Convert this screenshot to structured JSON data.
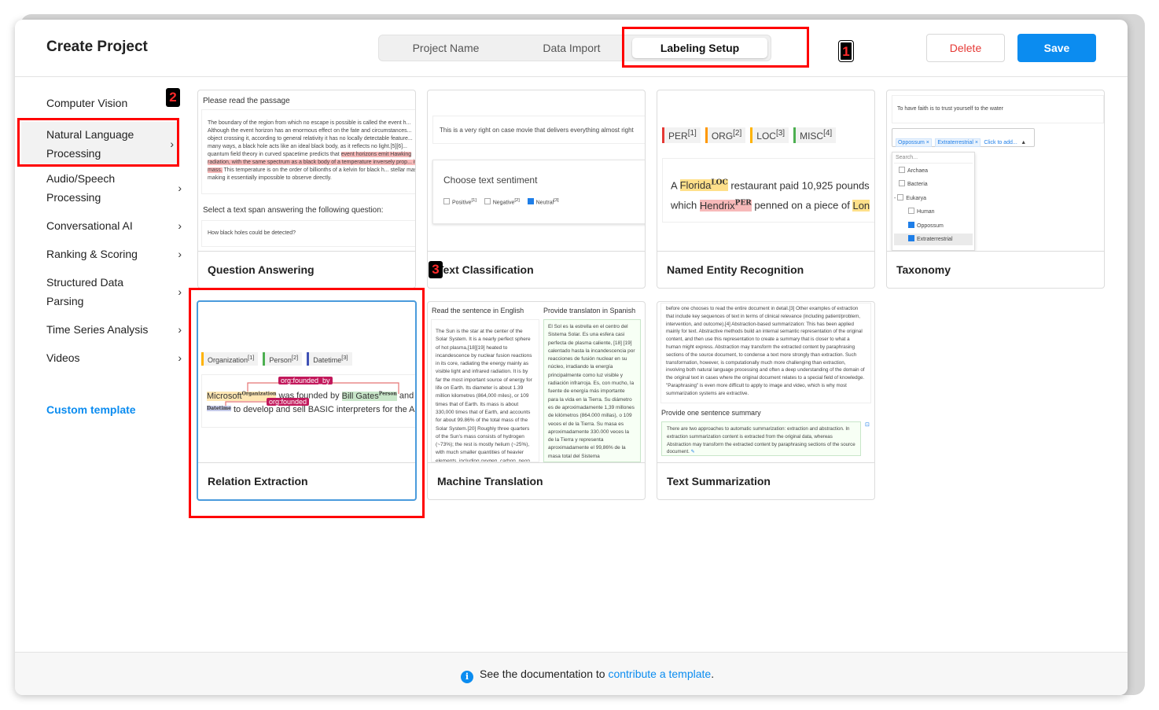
{
  "header": {
    "title": "Create Project",
    "tabs": [
      "Project Name",
      "Data Import",
      "Labeling Setup"
    ],
    "delete_label": "Delete",
    "save_label": "Save",
    "marker_1": "1"
  },
  "sidebar": {
    "items": [
      {
        "label": "Computer Vision"
      },
      {
        "label": "Natural Language Processing"
      },
      {
        "label": "Audio/Speech Processing"
      },
      {
        "label": "Conversational AI"
      },
      {
        "label": "Ranking & Scoring"
      },
      {
        "label": "Structured Data Parsing"
      },
      {
        "label": "Time Series Analysis"
      },
      {
        "label": "Videos"
      }
    ],
    "custom_template": "Custom template",
    "marker_2": "2"
  },
  "cards": {
    "qa": {
      "title": "Question Answering",
      "p1": "Please read the passage",
      "passage_a": "The boundary of the region from which no escape is possible is called the event h... Although the event horizon has an enormous effect on the fate and circumstances... object crossing it, according to general relativity it has no locally detectable feature... many ways, a black hole acts like an ideal black body, as it reflects no light.[5][6]... quantum field theory in curved spacetime predicts that",
      "passage_hl": "event horizons emit Hawking radiation, with the same spectrum as a black body of a temperature inversely prop... its mass.",
      "passage_b": "This temperature is on the order of billionths of a kelvin for black h... stellar mass, making it essentially impossible to observe directly.",
      "p2": "Select a text span answering the following question:",
      "question": "How black holes could be detected?"
    },
    "tc": {
      "title": "Text Classification",
      "sentence": "This is a very right on case movie that delivers everything almost right",
      "choose": "Choose text sentiment",
      "options": [
        "Positive",
        "Negative",
        "Neutral"
      ],
      "marker_3": "3"
    },
    "ner": {
      "title": "Named Entity Recognition",
      "tags": [
        "PER",
        "ORG",
        "LOC",
        "MISC"
      ],
      "sentence_1a": "A",
      "entity_1": "Florida",
      "entity_1_tag": "LOC",
      "sentence_1b": "restaurant paid 10,925 pounds",
      "sentence_2a": "which",
      "entity_2": "Hendrix",
      "entity_2_tag": "PER",
      "sentence_2b": "penned on a piece of",
      "entity_3": "Lon"
    },
    "tax": {
      "title": "Taxonomy",
      "quote": "To have faith is to trust yourself to the water",
      "selected": [
        "Oppossum",
        "Extraterrestrial"
      ],
      "click_to_add": "Click to add...",
      "search": "Search...",
      "tree": [
        "Archaea",
        "Bacteria",
        "Eukarya",
        "Human",
        "Oppossum",
        "Extraterrestrial"
      ]
    },
    "re": {
      "title": "Relation Extraction",
      "tags": [
        "Organization",
        "Person",
        "Datetime"
      ],
      "rel_1": "org:founded_by",
      "rel_2": "org:founded",
      "line_1a": "Microsoft",
      "line_1b": "was founded by",
      "line_1c": "Bill Gates",
      "line_1d": "and",
      "line_2": "to develop and sell BASIC interpreters for the Al"
    },
    "mt": {
      "title": "Machine Translation",
      "left_head": "Read the sentence in English",
      "right_head": "Provide translaton in Spanish",
      "left_text": "The Sun is the star at the center of the Solar System. It is a nearly perfect sphere of hot plasma,[18][19] heated to incandescence by nuclear fusion reactions in its core, radiating the energy mainly as visible light and infrared radiation. It is by far the most important source of energy for life on Earth. Its diameter is about 1.39 million kilometres (864,000 miles), or 109 times that of Earth. Its mass is about 330,000 times that of Earth, and accounts for about 99.86% of the total mass of the Solar System.[20] Roughly three quarters of the Sun's mass consists of hydrogen (~73%); the rest is mostly helium (~25%), with much smaller quantities of heavier elements, including oxygen, carbon, neon,",
      "right_text": "El Sol es la estrella en el centro del Sistema Solar. Es una esfera casi perfecta de plasma caliente, [18] [19] calentado hasta la incandescencia por reacciones de fusión nuclear en su núcleo, irradiando la energía principalmente como luz visible y radiación infrarroja. Es, con mucho, la fuente de energía más importante para la vida en la Tierra. Su diámetro es de aproximadamente 1,39 millones de kilómetros (864.000 millas), o 109 veces el de la Tierra. Su masa es aproximadamente 330.000 veces la de la Tierra y representa aproximadamente el 99,86% de la masa total del Sistema"
    },
    "ts": {
      "title": "Text Summarization",
      "doc": "before one chooses to read the entire document in detail.[3] Other examples of extraction that include key sequences of text in terms of clinical relevance (including patient/problem, intervention, and outcome).[4] Abstraction-based summarization: This has been applied mainly for text. Abstractive methods build an internal semantic representation of the original content, and then use this representation to create a summary that is closer to what a human might express. Abstraction may transform the extracted content by paraphrasing sections of the source document, to condense a text more strongly than extraction. Such transformation, however, is computationally much more challenging than extraction, involving both natural language processing and often a deep understanding of the domain of the original text in cases where the original document relates to a special field of knowledge. \"Paraphrasing\" is even more difficult to apply to image and video, which is why most summarization systems are extractive.",
      "prompt": "Provide one sentence summary",
      "summary": "There are two approaches to automatic summarization: extraction and abstraction. In extraction summarization content is extracted from the original data, whereas Abstraction may transform the extracted content by paraphrasing sections of the source document."
    }
  },
  "footer": {
    "prefix": "See the documentation to ",
    "link": "contribute a template",
    "suffix": "."
  },
  "colors": {
    "accent": "#0b8cf0",
    "delete": "#e53935",
    "highlight_box": "#ff0000"
  }
}
